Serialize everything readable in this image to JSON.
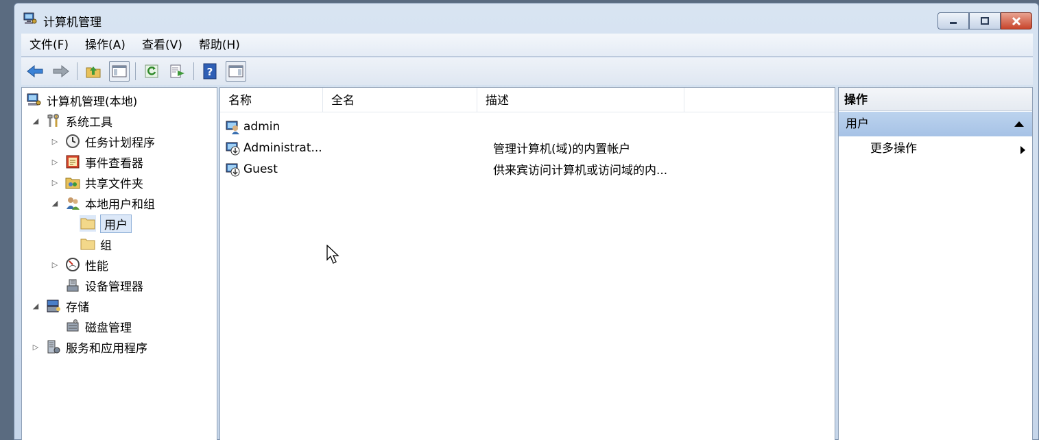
{
  "window": {
    "title": "计算机管理"
  },
  "menubar": {
    "items": [
      "文件(F)",
      "操作(A)",
      "查看(V)",
      "帮助(H)"
    ]
  },
  "tree": {
    "root": "计算机管理(本地)",
    "system_tools": "系统工具",
    "task_scheduler": "任务计划程序",
    "event_viewer": "事件查看器",
    "shared_folders": "共享文件夹",
    "local_users_groups": "本地用户和组",
    "users": "用户",
    "groups": "组",
    "performance": "性能",
    "device_manager": "设备管理器",
    "storage": "存储",
    "disk_management": "磁盘管理",
    "services_apps": "服务和应用程序"
  },
  "list": {
    "columns": [
      "名称",
      "全名",
      "描述"
    ],
    "rows": [
      {
        "name": "admin",
        "fullname": "",
        "description": ""
      },
      {
        "name": "Administrat...",
        "fullname": "",
        "description": "管理计算机(域)的内置帐户"
      },
      {
        "name": "Guest",
        "fullname": "",
        "description": "供来宾访问计算机或访问域的内..."
      }
    ]
  },
  "actions": {
    "title": "操作",
    "section": "用户",
    "more": "更多操作"
  }
}
